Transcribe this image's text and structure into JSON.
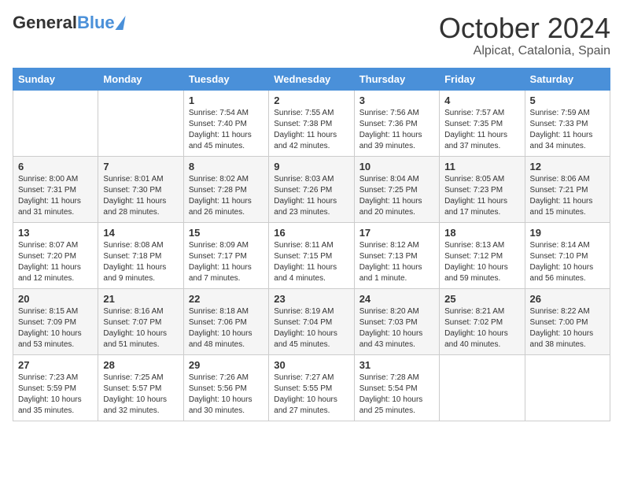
{
  "header": {
    "logo_general": "General",
    "logo_blue": "Blue",
    "title": "October 2024",
    "location": "Alpicat, Catalonia, Spain"
  },
  "days_of_week": [
    "Sunday",
    "Monday",
    "Tuesday",
    "Wednesday",
    "Thursday",
    "Friday",
    "Saturday"
  ],
  "weeks": [
    [
      {
        "day": "",
        "info": ""
      },
      {
        "day": "",
        "info": ""
      },
      {
        "day": "1",
        "info": "Sunrise: 7:54 AM\nSunset: 7:40 PM\nDaylight: 11 hours and 45 minutes."
      },
      {
        "day": "2",
        "info": "Sunrise: 7:55 AM\nSunset: 7:38 PM\nDaylight: 11 hours and 42 minutes."
      },
      {
        "day": "3",
        "info": "Sunrise: 7:56 AM\nSunset: 7:36 PM\nDaylight: 11 hours and 39 minutes."
      },
      {
        "day": "4",
        "info": "Sunrise: 7:57 AM\nSunset: 7:35 PM\nDaylight: 11 hours and 37 minutes."
      },
      {
        "day": "5",
        "info": "Sunrise: 7:59 AM\nSunset: 7:33 PM\nDaylight: 11 hours and 34 minutes."
      }
    ],
    [
      {
        "day": "6",
        "info": "Sunrise: 8:00 AM\nSunset: 7:31 PM\nDaylight: 11 hours and 31 minutes."
      },
      {
        "day": "7",
        "info": "Sunrise: 8:01 AM\nSunset: 7:30 PM\nDaylight: 11 hours and 28 minutes."
      },
      {
        "day": "8",
        "info": "Sunrise: 8:02 AM\nSunset: 7:28 PM\nDaylight: 11 hours and 26 minutes."
      },
      {
        "day": "9",
        "info": "Sunrise: 8:03 AM\nSunset: 7:26 PM\nDaylight: 11 hours and 23 minutes."
      },
      {
        "day": "10",
        "info": "Sunrise: 8:04 AM\nSunset: 7:25 PM\nDaylight: 11 hours and 20 minutes."
      },
      {
        "day": "11",
        "info": "Sunrise: 8:05 AM\nSunset: 7:23 PM\nDaylight: 11 hours and 17 minutes."
      },
      {
        "day": "12",
        "info": "Sunrise: 8:06 AM\nSunset: 7:21 PM\nDaylight: 11 hours and 15 minutes."
      }
    ],
    [
      {
        "day": "13",
        "info": "Sunrise: 8:07 AM\nSunset: 7:20 PM\nDaylight: 11 hours and 12 minutes."
      },
      {
        "day": "14",
        "info": "Sunrise: 8:08 AM\nSunset: 7:18 PM\nDaylight: 11 hours and 9 minutes."
      },
      {
        "day": "15",
        "info": "Sunrise: 8:09 AM\nSunset: 7:17 PM\nDaylight: 11 hours and 7 minutes."
      },
      {
        "day": "16",
        "info": "Sunrise: 8:11 AM\nSunset: 7:15 PM\nDaylight: 11 hours and 4 minutes."
      },
      {
        "day": "17",
        "info": "Sunrise: 8:12 AM\nSunset: 7:13 PM\nDaylight: 11 hours and 1 minute."
      },
      {
        "day": "18",
        "info": "Sunrise: 8:13 AM\nSunset: 7:12 PM\nDaylight: 10 hours and 59 minutes."
      },
      {
        "day": "19",
        "info": "Sunrise: 8:14 AM\nSunset: 7:10 PM\nDaylight: 10 hours and 56 minutes."
      }
    ],
    [
      {
        "day": "20",
        "info": "Sunrise: 8:15 AM\nSunset: 7:09 PM\nDaylight: 10 hours and 53 minutes."
      },
      {
        "day": "21",
        "info": "Sunrise: 8:16 AM\nSunset: 7:07 PM\nDaylight: 10 hours and 51 minutes."
      },
      {
        "day": "22",
        "info": "Sunrise: 8:18 AM\nSunset: 7:06 PM\nDaylight: 10 hours and 48 minutes."
      },
      {
        "day": "23",
        "info": "Sunrise: 8:19 AM\nSunset: 7:04 PM\nDaylight: 10 hours and 45 minutes."
      },
      {
        "day": "24",
        "info": "Sunrise: 8:20 AM\nSunset: 7:03 PM\nDaylight: 10 hours and 43 minutes."
      },
      {
        "day": "25",
        "info": "Sunrise: 8:21 AM\nSunset: 7:02 PM\nDaylight: 10 hours and 40 minutes."
      },
      {
        "day": "26",
        "info": "Sunrise: 8:22 AM\nSunset: 7:00 PM\nDaylight: 10 hours and 38 minutes."
      }
    ],
    [
      {
        "day": "27",
        "info": "Sunrise: 7:23 AM\nSunset: 5:59 PM\nDaylight: 10 hours and 35 minutes."
      },
      {
        "day": "28",
        "info": "Sunrise: 7:25 AM\nSunset: 5:57 PM\nDaylight: 10 hours and 32 minutes."
      },
      {
        "day": "29",
        "info": "Sunrise: 7:26 AM\nSunset: 5:56 PM\nDaylight: 10 hours and 30 minutes."
      },
      {
        "day": "30",
        "info": "Sunrise: 7:27 AM\nSunset: 5:55 PM\nDaylight: 10 hours and 27 minutes."
      },
      {
        "day": "31",
        "info": "Sunrise: 7:28 AM\nSunset: 5:54 PM\nDaylight: 10 hours and 25 minutes."
      },
      {
        "day": "",
        "info": ""
      },
      {
        "day": "",
        "info": ""
      }
    ]
  ]
}
